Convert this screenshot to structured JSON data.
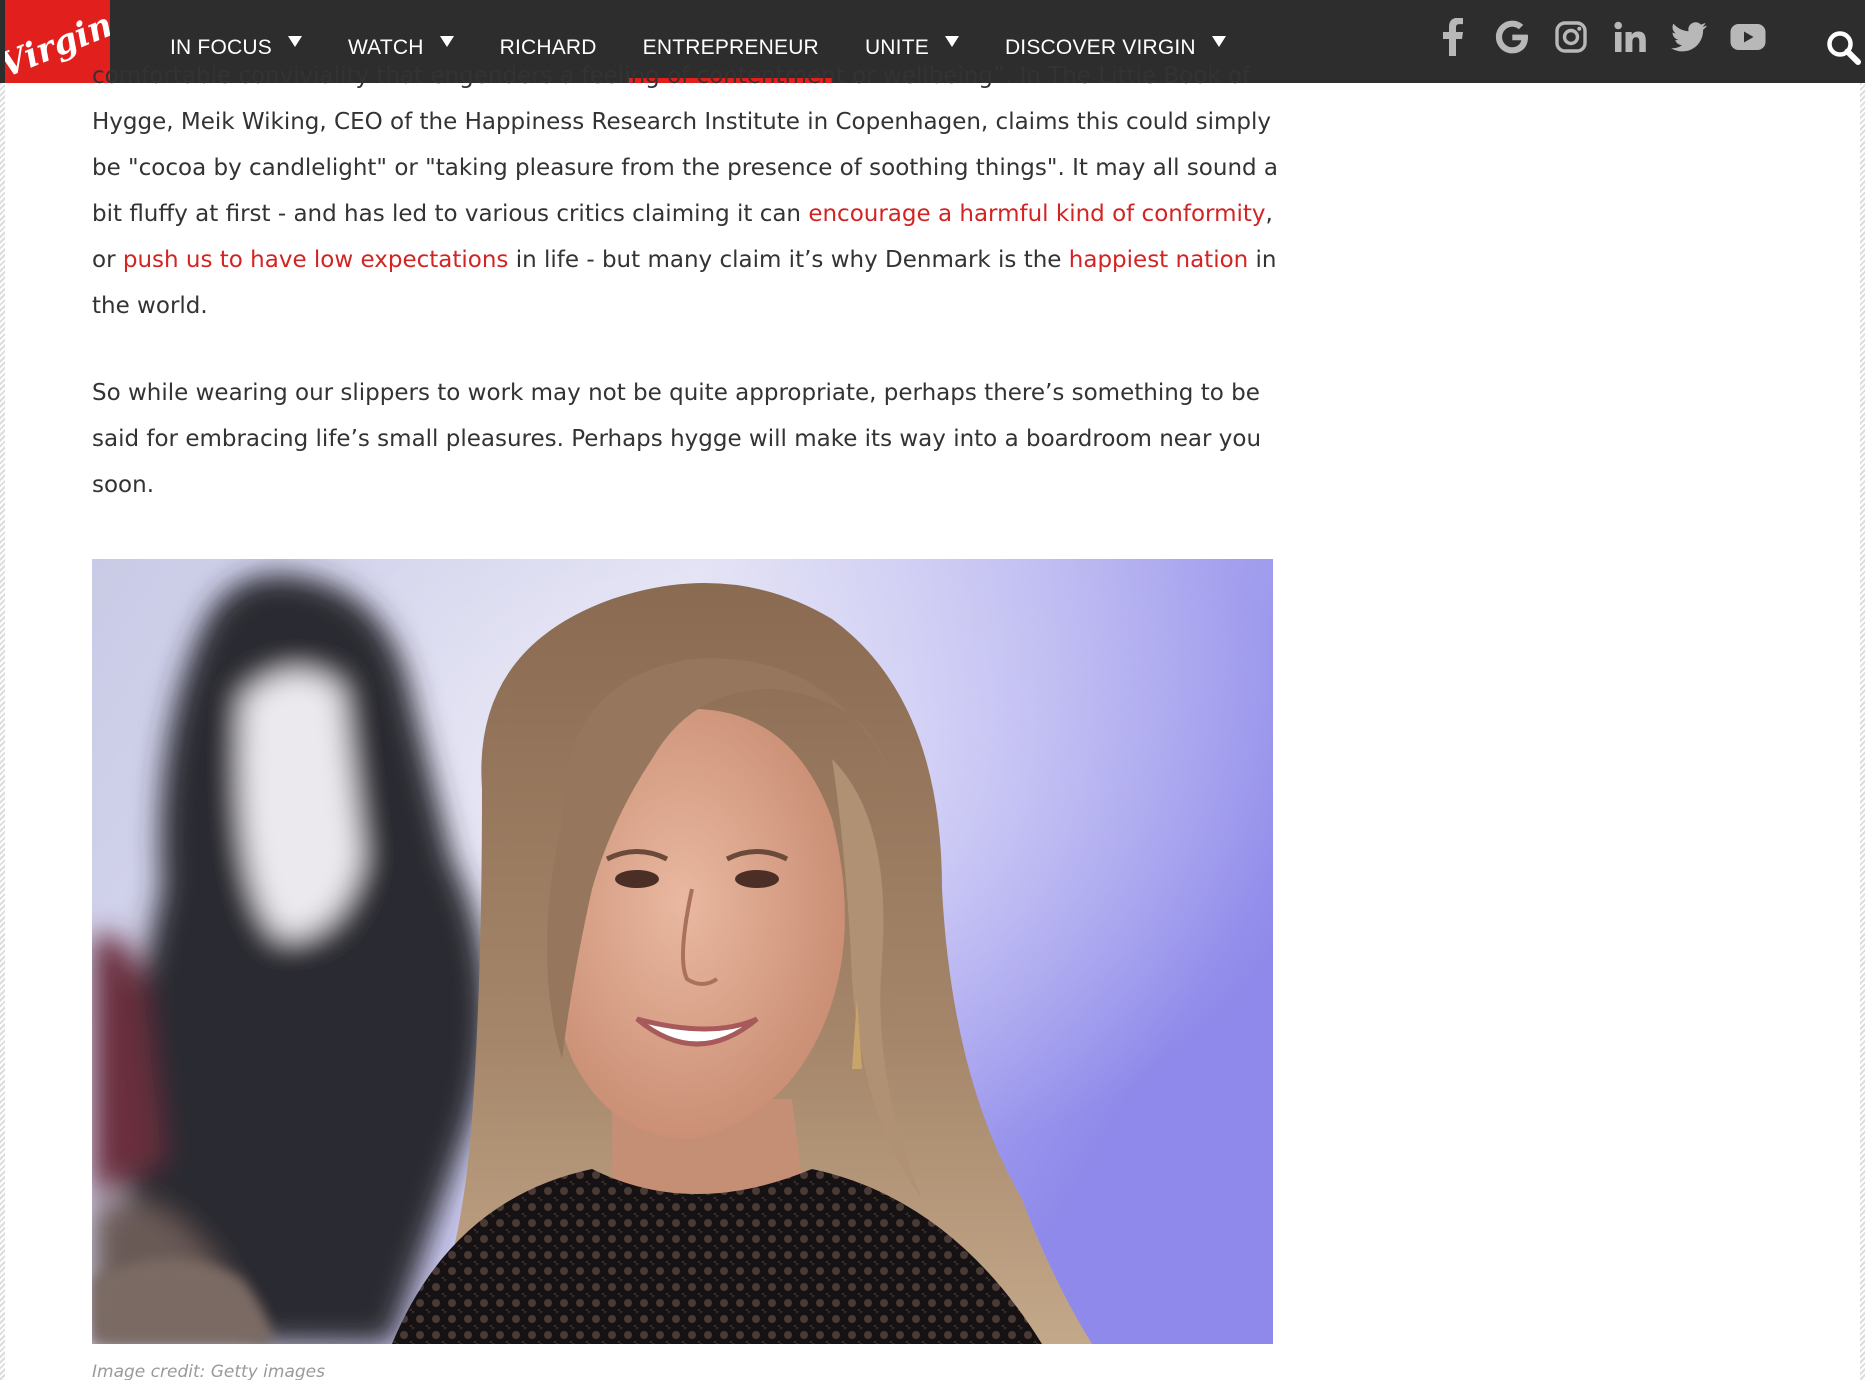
{
  "brand": {
    "name": "Virgin",
    "color": "#e1201d"
  },
  "nav": {
    "items": [
      {
        "label": "IN FOCUS",
        "has_dropdown": true
      },
      {
        "label": "WATCH",
        "has_dropdown": true
      },
      {
        "label": "RICHARD",
        "has_dropdown": false
      },
      {
        "label": "ENTREPRENEUR",
        "has_dropdown": false,
        "active": true
      },
      {
        "label": "UNITE",
        "has_dropdown": true
      },
      {
        "label": "DISCOVER VIRGIN",
        "has_dropdown": true
      }
    ]
  },
  "social": {
    "icons": [
      "facebook-icon",
      "google-icon",
      "instagram-icon",
      "linkedin-icon",
      "twitter-icon",
      "youtube-icon"
    ]
  },
  "search": {
    "icon": "search-icon"
  },
  "article": {
    "para1": {
      "text1": "comfortable conviviality that engenders a feeling of contentment or wellbeing”. In The Little Book of Hygge, Meik Wiking, CEO of the Happiness Research Institute in Copenhagen, claims this could simply be \"cocoa by candlelight\" or \"taking pleasure from the presence of soothing things\". It may all sound a bit fluffy at first - and has led to various critics claiming it can ",
      "link1": "encourage a harmful kind of conformity",
      "text2": ", or ",
      "link2": "push us to have low expectations",
      "text3": " in life - but many claim it’s why Denmark is the ",
      "link3": "happiest nation",
      "text4": " in the world."
    },
    "para2": "So while wearing our slippers to work may not be quite appropriate, perhaps there’s something to be said for embracing life’s small pleasures. Perhaps hygge will make its way into a boardroom near you soon.",
    "link_color": "#d32424",
    "text_color": "#333333"
  },
  "image": {
    "caption": "Image credit: Getty images"
  }
}
